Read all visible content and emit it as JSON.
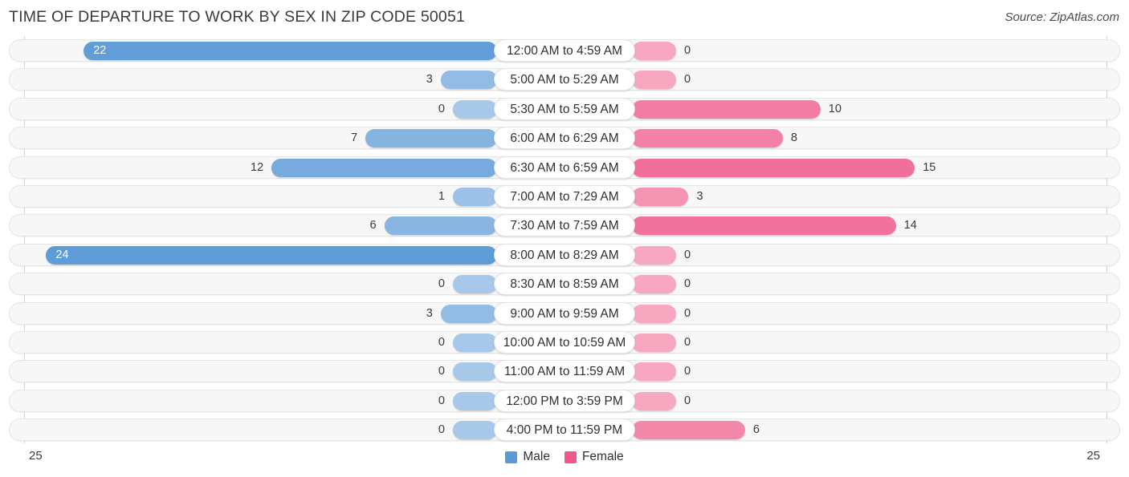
{
  "header": {
    "title": "TIME OF DEPARTURE TO WORK BY SEX IN ZIP CODE 50051",
    "source": "Source: ZipAtlas.com"
  },
  "axis": {
    "left_end_label": "25",
    "right_end_label": "25",
    "max": 25
  },
  "legend": {
    "items": [
      {
        "label": "Male",
        "color": "#5b9bd5"
      },
      {
        "label": "Female",
        "color": "#f0588c"
      }
    ]
  },
  "colors": {
    "male_strong": "#5b9bd5",
    "male_light": "#a8c8ea",
    "female_strong": "#ef5b8c",
    "female_light": "#f7a8c0",
    "track": "#f7f7f7",
    "gridline": "#d2d2d2"
  },
  "chart_data": {
    "type": "bar",
    "title": "TIME OF DEPARTURE TO WORK BY SEX IN ZIP CODE 50051",
    "xlabel": "",
    "ylabel": "",
    "orientation": "horizontal-diverging",
    "xlim": [
      0,
      25
    ],
    "grid": true,
    "legend_position": "bottom-center",
    "categories": [
      "12:00 AM to 4:59 AM",
      "5:00 AM to 5:29 AM",
      "5:30 AM to 5:59 AM",
      "6:00 AM to 6:29 AM",
      "6:30 AM to 6:59 AM",
      "7:00 AM to 7:29 AM",
      "7:30 AM to 7:59 AM",
      "8:00 AM to 8:29 AM",
      "8:30 AM to 8:59 AM",
      "9:00 AM to 9:59 AM",
      "10:00 AM to 10:59 AM",
      "11:00 AM to 11:59 AM",
      "12:00 PM to 3:59 PM",
      "4:00 PM to 11:59 PM"
    ],
    "series": [
      {
        "name": "Male",
        "color": "#5b9bd5",
        "values": [
          22,
          3,
          0,
          7,
          12,
          1,
          6,
          24,
          0,
          3,
          0,
          0,
          0,
          0
        ]
      },
      {
        "name": "Female",
        "color": "#ef5b8c",
        "values": [
          0,
          0,
          10,
          8,
          15,
          3,
          14,
          0,
          0,
          0,
          0,
          0,
          0,
          6
        ]
      }
    ]
  }
}
